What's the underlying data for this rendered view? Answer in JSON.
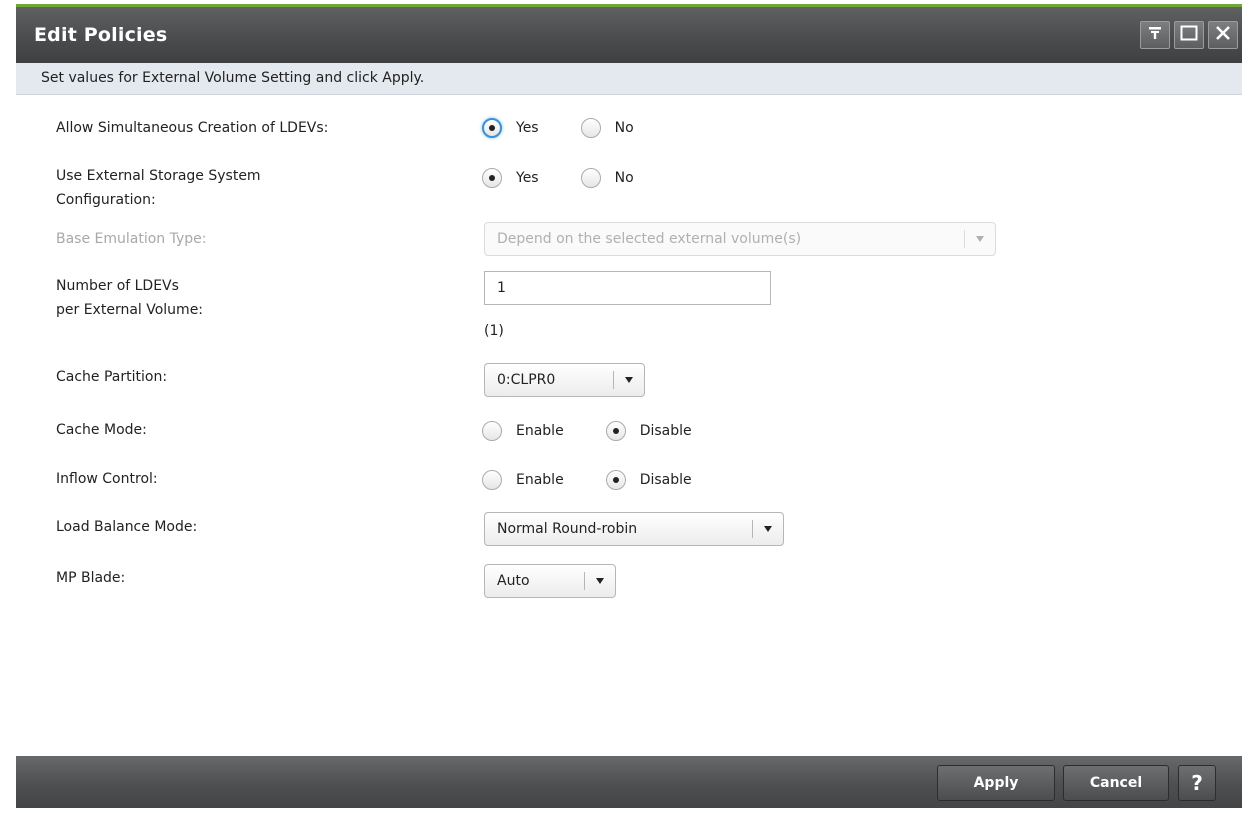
{
  "dialog": {
    "title": "Edit Policies",
    "instruction": "Set values for External Volume Setting and click Apply."
  },
  "fields": {
    "simultaneous": {
      "label": "Allow Simultaneous Creation of LDEVs:",
      "options": [
        "Yes",
        "No"
      ],
      "selected": "Yes"
    },
    "external_config": {
      "label_line1": "Use External Storage System",
      "label_line2": "Configuration:",
      "options": [
        "Yes",
        "No"
      ],
      "selected": "Yes"
    },
    "base_emulation": {
      "label": "Base Emulation Type:",
      "value": "Depend on the selected external volume(s)",
      "disabled": true
    },
    "ldev_count": {
      "label_line1": "Number of LDEVs",
      "label_line2": "per External Volume:",
      "value": "1",
      "hint": "(1)"
    },
    "cache_partition": {
      "label": "Cache Partition:",
      "value": "0:CLPR0"
    },
    "cache_mode": {
      "label": "Cache Mode:",
      "options": [
        "Enable",
        "Disable"
      ],
      "selected": "Disable"
    },
    "inflow_control": {
      "label": "Inflow Control:",
      "options": [
        "Enable",
        "Disable"
      ],
      "selected": "Disable"
    },
    "load_balance": {
      "label": "Load Balance Mode:",
      "value": "Normal Round-robin"
    },
    "mp_blade": {
      "label": "MP Blade:",
      "value": "Auto"
    }
  },
  "footer": {
    "apply_label": "Apply",
    "cancel_label": "Cancel",
    "help_label": "?"
  },
  "icons": {
    "titlebar": [
      "pin-icon",
      "maximize-icon",
      "close-icon"
    ],
    "dropdown": "chevron-down-icon"
  },
  "colors": {
    "titlebar_accent": "#6fa83a",
    "focus_ring": "#3b8fd8",
    "instruction_bg": "#e4e8ef"
  }
}
